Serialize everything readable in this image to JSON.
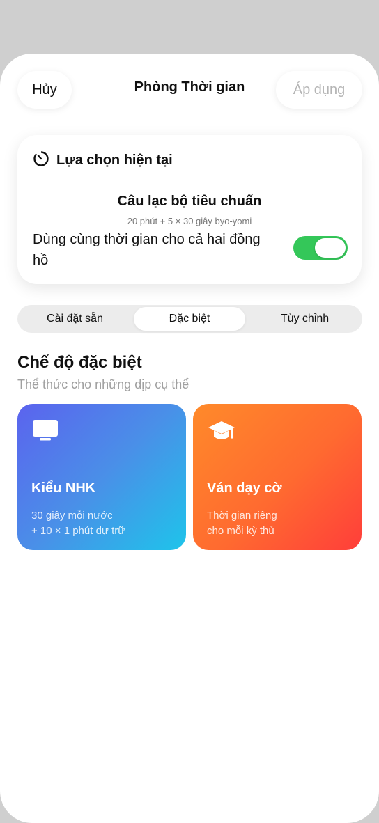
{
  "header": {
    "cancel_label": "Hủy",
    "title": "Phòng Thời gian",
    "apply_label": "Áp dụng"
  },
  "current_selection": {
    "heading": "Lựa chọn hiện tại",
    "preset_name": "Câu lạc bộ tiêu chuẩn",
    "preset_detail": "20 phút + 5 × 30 giây byo-yomi",
    "same_time_label": "Dùng cùng thời gian cho cả hai đồng hồ",
    "same_time_enabled": true
  },
  "tabs": [
    {
      "label": "Cài đặt sẵn",
      "selected": false
    },
    {
      "label": "Đặc biệt",
      "selected": true
    },
    {
      "label": "Tùy chỉnh",
      "selected": false
    }
  ],
  "special_modes": {
    "title": "Chế độ đặc biệt",
    "subtitle": "Thể thức cho những dịp cụ thể",
    "modes": [
      {
        "name": "Kiểu NHK",
        "desc_line1": "30 giây mỗi nước",
        "desc_line2": "+ 10 × 1 phút dự trữ",
        "icon": "tv-icon"
      },
      {
        "name": "Ván dạy cờ",
        "desc_line1": "Thời gian riêng",
        "desc_line2": "cho mỗi kỳ thủ",
        "icon": "graduation-cap-icon"
      }
    ]
  },
  "colors": {
    "toggle_on": "#34c759",
    "apply_disabled_text": "#b5b5b5",
    "nhk_gradient_start": "#5b63ee",
    "nhk_gradient_end": "#1ec4ea",
    "teach_gradient_start": "#ff8a2a",
    "teach_gradient_end": "#ff3e3a"
  }
}
